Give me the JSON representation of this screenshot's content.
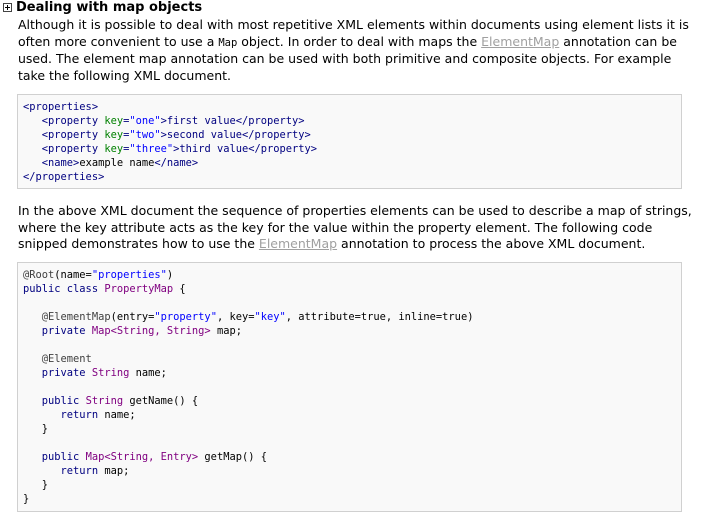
{
  "section": {
    "title": "Dealing with map objects"
  },
  "paragraph1": {
    "t1": "Although it is possible to deal with most repetitive XML elements within documents using element lists it is often more convenient to use a ",
    "code": "Map",
    "t2": " object. In order to deal with maps the ",
    "link": "ElementMap",
    "t3": " annotation can be used. The element map annotation can be used with both primitive and composite objects. For example take the following XML document."
  },
  "xml_example": {
    "lines": [
      [
        {
          "t": "<properties>",
          "c": "tag"
        }
      ],
      [
        {
          "t": "   <property ",
          "c": "tag"
        },
        {
          "t": "key",
          "c": "attr"
        },
        {
          "t": "=",
          "c": "tag"
        },
        {
          "t": "\"one\"",
          "c": "str"
        },
        {
          "t": ">first value</property>",
          "c": "tag"
        }
      ],
      [
        {
          "t": "   <property ",
          "c": "tag"
        },
        {
          "t": "key",
          "c": "attr"
        },
        {
          "t": "=",
          "c": "tag"
        },
        {
          "t": "\"two\"",
          "c": "str"
        },
        {
          "t": ">second value</property>",
          "c": "tag"
        }
      ],
      [
        {
          "t": "   <property ",
          "c": "tag"
        },
        {
          "t": "key",
          "c": "attr"
        },
        {
          "t": "=",
          "c": "tag"
        },
        {
          "t": "\"three\"",
          "c": "str"
        },
        {
          "t": ">third value</property>",
          "c": "tag"
        }
      ],
      [
        {
          "t": "   <name>",
          "c": "tag"
        },
        {
          "t": "example name",
          "c": "plain"
        },
        {
          "t": "</name>",
          "c": "tag"
        }
      ],
      [
        {
          "t": "</properties>",
          "c": "tag"
        }
      ]
    ]
  },
  "paragraph2": {
    "t1": "In the above XML document the sequence of properties elements can be used to describe a map of strings, where the key attribute acts as the key for the value within the property element. The following code snipped demonstrates how to use the ",
    "link": "ElementMap",
    "t2": " annotation to process the above XML document."
  },
  "java_example": {
    "lines": [
      [
        {
          "t": "@Root",
          "c": "ann"
        },
        {
          "t": "(name=",
          "c": "plain"
        },
        {
          "t": "\"properties\"",
          "c": "str"
        },
        {
          "t": ")",
          "c": "plain"
        }
      ],
      [
        {
          "t": "public class ",
          "c": "kw"
        },
        {
          "t": "PropertyMap",
          "c": "type"
        },
        {
          "t": " {",
          "c": "plain"
        }
      ],
      [],
      [
        {
          "t": "   @ElementMap",
          "c": "ann"
        },
        {
          "t": "(entry=",
          "c": "plain"
        },
        {
          "t": "\"property\"",
          "c": "str"
        },
        {
          "t": ", key=",
          "c": "plain"
        },
        {
          "t": "\"key\"",
          "c": "str"
        },
        {
          "t": ", attribute=true, inline=true)",
          "c": "plain"
        }
      ],
      [
        {
          "t": "   private ",
          "c": "kw"
        },
        {
          "t": "Map<String, String>",
          "c": "type"
        },
        {
          "t": " map;",
          "c": "plain"
        }
      ],
      [],
      [
        {
          "t": "   @Element",
          "c": "ann"
        }
      ],
      [
        {
          "t": "   private ",
          "c": "kw"
        },
        {
          "t": "String",
          "c": "type"
        },
        {
          "t": " name;",
          "c": "plain"
        }
      ],
      [],
      [
        {
          "t": "   public ",
          "c": "kw"
        },
        {
          "t": "String",
          "c": "type"
        },
        {
          "t": " getName() {",
          "c": "plain"
        }
      ],
      [
        {
          "t": "      return ",
          "c": "kw"
        },
        {
          "t": "name;",
          "c": "plain"
        }
      ],
      [
        {
          "t": "   }",
          "c": "plain"
        }
      ],
      [],
      [
        {
          "t": "   public ",
          "c": "kw"
        },
        {
          "t": "Map<String, Entry>",
          "c": "type"
        },
        {
          "t": " getMap() {",
          "c": "plain"
        }
      ],
      [
        {
          "t": "      return ",
          "c": "kw"
        },
        {
          "t": "map;",
          "c": "plain"
        }
      ],
      [
        {
          "t": "   }",
          "c": "plain"
        }
      ],
      [
        {
          "t": "}",
          "c": "plain"
        }
      ]
    ]
  }
}
